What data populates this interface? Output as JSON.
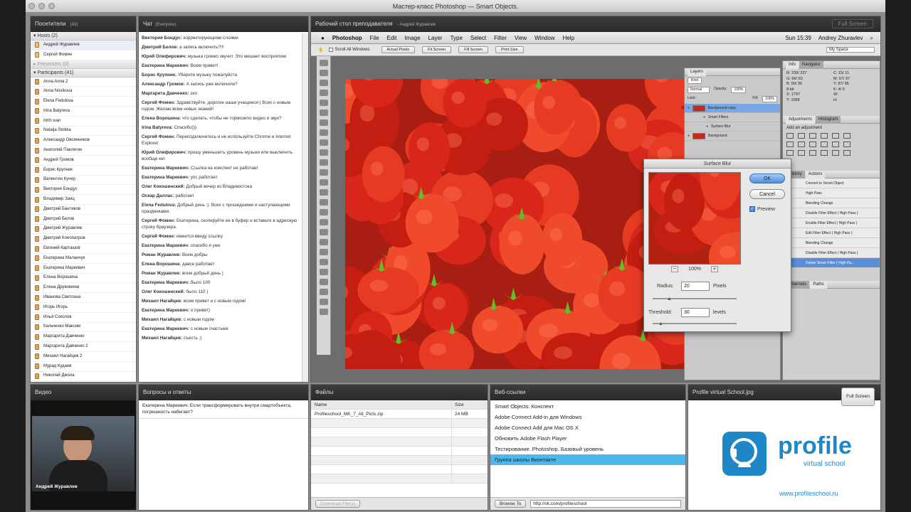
{
  "window": {
    "title": "Мастер-класс Photoshop — Smart Objects.",
    "full_screen_label": "Full Screen"
  },
  "attendees": {
    "title": "Посетители",
    "count": "(43)",
    "hosts_label": "Hosts (2)",
    "hosts": [
      "Андрей Журавлев",
      "Сергей Фомин"
    ],
    "presenters_label": "Presenters (0)",
    "participants_label": "Participants (41)",
    "participants": [
      "Anna Anna 2",
      "Anna Novikova",
      "Elena Fedulova",
      "Irina Batyreva",
      "Iririh ivan",
      "Natalja Stotika",
      "Александр Овсянников",
      "Анатолий Паклягин",
      "Андрей Громов",
      "Борис Крупник",
      "Валентин Кучер",
      "Виктория Бондус",
      "Владимир Заяц",
      "Дмитрий Бантиков",
      "Дмитрий Белов",
      "Дмитрий Журавлев",
      "Дмитрий Клеопатров",
      "Евгений Карташов",
      "Екатерина Маланчук",
      "Екатерина Маркевич",
      "Елена Ворошина",
      "Елена Дружинина",
      "Иванова Светлана",
      "Игорь Игорь",
      "Илья Соколов",
      "Кальченко Максим",
      "Маргарита Давченко",
      "Маргарита Давченко 2",
      "Михаил Нагайцев 2",
      "Мурад Кудаев",
      "Николай Джола"
    ]
  },
  "chat": {
    "title": "Чат",
    "audience": "(Everyone)",
    "messages": [
      {
        "author": "Виктория Бондус:",
        "text": "корректирующими слоями"
      },
      {
        "author": "Дмитрий Белов:",
        "text": "а запись включить?!!!"
      },
      {
        "author": "Юрий Олифирович:",
        "text": "музыка громко звучит. Это мешает восприятию"
      },
      {
        "author": "Екатерина Маркевич:",
        "text": "Всем привет!"
      },
      {
        "author": "Борис Крупник:",
        "text": "Уберите музыку пожалуйста"
      },
      {
        "author": "Александр Громов:",
        "text": "А запись уже включили?"
      },
      {
        "author": "Маргарита Давченко:",
        "text": "эхо"
      },
      {
        "author": "Сергей Фомин:",
        "text": "Здравствуйте, дорогие наши учащиеся:) Всех с новым годом. Желаю всем новых знаний!"
      },
      {
        "author": "Елена Ворошина:",
        "text": "что сделать, чтобы не тормозило видео и звук?"
      },
      {
        "author": "Irina Batyreva:",
        "text": "Спасибо)))"
      },
      {
        "author": "Сергей Фомин:",
        "text": "Переподключитесь и не используйте Chrome и Internet Explorer."
      },
      {
        "author": "Юрий Олифирович:",
        "text": "прошу уменьшить уровень музыки или выключить вообще ее\\"
      },
      {
        "author": "Екатерина Маркевич:",
        "text": "Ссылка на конспект не работает"
      },
      {
        "author": "Екатерина Маркевич:",
        "text": "упс работает"
      },
      {
        "author": "Олег Кокошинский:",
        "text": "Добрый вечер из Владивостока"
      },
      {
        "author": "Оскар Даллас:",
        "text": "работает"
      },
      {
        "author": "Elena Fedulova:",
        "text": "Добрый день :). Всех с прошедшими и наступающими праздниками."
      },
      {
        "author": "Сергей Фомин:",
        "text": "Екатерина, скопируйте ее в буфер и вставьте в адресную строку браузера."
      },
      {
        "author": "Сергей Фомин:",
        "text": "имеется ввиду ссылку"
      },
      {
        "author": "Екатерина Маркевич:",
        "text": "спасибо я уже"
      },
      {
        "author": "Роман Журавлев:",
        "text": "Всем добры"
      },
      {
        "author": "Елена Ворошина:",
        "text": "давсе работает"
      },
      {
        "author": "Роман Журавлев:",
        "text": "всем добрый день )"
      },
      {
        "author": "Екатерина Маркевич:",
        "text": "было 100"
      },
      {
        "author": "Олег Кокошинский:",
        "text": "было 110 )"
      },
      {
        "author": "Михаил Нагайцев:",
        "text": "всем привет и с новым годом!"
      },
      {
        "author": "Екатерина Маркевич:",
        "text": "о привет)"
      },
      {
        "author": "Михаил Нагайцев:",
        "text": "с новым годом"
      },
      {
        "author": "Екатерина Маркевич:",
        "text": "с новым счастьем"
      },
      {
        "author": "Михаил Нагайцев:",
        "text": "съесть ;)"
      }
    ]
  },
  "desktop": {
    "title": "Рабочий стол преподавателя",
    "presenter": "- Андрей Журавлев"
  },
  "photoshop": {
    "menu": [
      "Photoshop",
      "File",
      "Edit",
      "Image",
      "Layer",
      "Type",
      "Select",
      "Filter",
      "View",
      "Window",
      "Help"
    ],
    "clock": "Sun 15:39",
    "user": "Andrey Zhuravlev",
    "options": {
      "scroll_all": "Scroll All Windows",
      "buttons": [
        "Actual Pixels",
        "Fit Screen",
        "Fill Screen",
        "Print Size"
      ],
      "workspace": "My Space"
    },
    "layers_panel": {
      "tab": "Layers",
      "kind": "Kind",
      "blend": "Normal",
      "opacity_label": "Opacity:",
      "opacity": "100%",
      "lock_label": "Lock:",
      "fill_label": "Fill:",
      "fill": "100%",
      "layers": [
        {
          "name": "Background copy"
        },
        {
          "name": "Smart Filters"
        },
        {
          "name": "Surface Blur"
        },
        {
          "name": "Background"
        }
      ]
    },
    "info_panel": {
      "tabs": [
        "Info",
        "Navigator"
      ],
      "r_label": "R:",
      "r": "239/ 237",
      "g_label": "G:",
      "g": "66/ 50",
      "b_label": "B:",
      "b": "50/ 36",
      "bit": "8-bit",
      "x_label": "X:",
      "x": "1797",
      "y_label": "Y:",
      "y": "1058",
      "c_label": "C:",
      "c": "15/ 11",
      "m_label": "M:",
      "m": "97/ 97",
      "yv_label": "Y:",
      "yv": "87/ 95",
      "k_label": "K:",
      "k": "4/ 6",
      "w_label": "W:",
      "h_label": "H:"
    },
    "adjust_panel": {
      "tabs": [
        "Adjustments",
        "Histogram"
      ],
      "heading": "Add an adjustment"
    },
    "history_panel": {
      "tabs": [
        "History",
        "Actions"
      ],
      "items": [
        "Convert to Smart Object",
        "High Pass",
        "Blending Change",
        "Disable Filter Effect ( High Pass )",
        "Enable Filter Effect ( High Pass )",
        "Edit Filter Effect ( High Pass )",
        "Blending Change",
        "Disable Filter Effect ( High Pass )",
        "Delete Smart Filter ( High Pa..."
      ]
    },
    "channels_panel": {
      "tabs": [
        "Channels",
        "Paths"
      ]
    },
    "surface_blur": {
      "title": "Surface Blur",
      "ok": "OK",
      "cancel": "Cancel",
      "preview": "Preview",
      "zoom": "100%",
      "radius_label": "Radius:",
      "radius": "20",
      "radius_unit": "Pixels",
      "threshold_label": "Threshold:",
      "threshold": "30",
      "threshold_unit": "levels"
    }
  },
  "video": {
    "title": "Видео",
    "name": "Андрей Журавлев"
  },
  "qa": {
    "title": "Вопросы и ответы",
    "question": "Екатерина Маркевич: Если трансформировать внутри смартобъекта, погрешность набегает?"
  },
  "files": {
    "title": "Файлы",
    "col_name": "Name",
    "col_size": "Size",
    "rows": [
      {
        "name": "Profileschool_MK_7_All_Picts.zip",
        "size": "24 MB"
      }
    ],
    "download": "Download File(s)"
  },
  "links": {
    "title": "Веб-ссылки",
    "items": [
      "Smart Objects. Конспект",
      "Adobe Connect Add-in для Windows",
      "Adobe Connect Add для Mac OS X",
      "Обновить Adobe Flash Player",
      "Тестирование. Photoshop. Базовый уровень",
      "Группа школы Вконтакте"
    ],
    "selected_index": 5,
    "browse": "Browse To",
    "url": "http://vk.com/profileschool"
  },
  "profile": {
    "title": "Profile virtual School.jpg",
    "full_screen": "Full Screen",
    "brand": "profile",
    "tagline": "virtual school",
    "site": "www.profileschool.ru",
    "brand_color": "#1f87c5"
  }
}
